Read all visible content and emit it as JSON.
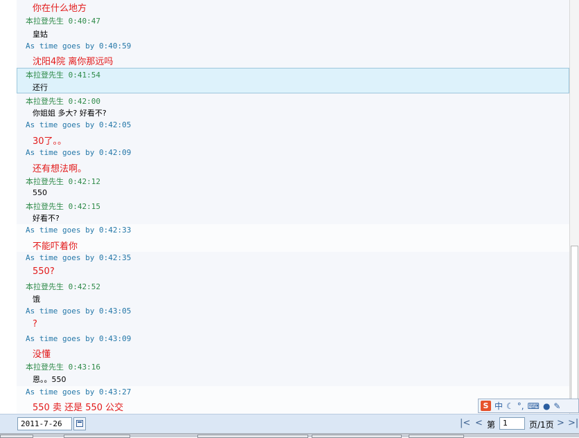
{
  "chat": {
    "messages": [
      {
        "meta": "",
        "text": "你在什么地方",
        "kind": "other"
      },
      {
        "meta": "本拉登先生 0:40:47",
        "text": "皇姑",
        "kind": "self"
      },
      {
        "meta": "As time goes by 0:40:59",
        "text": "沈阳4院 离你那远吗",
        "kind": "other"
      },
      {
        "meta": "本拉登先生 0:41:54",
        "text": "还行",
        "kind": "self"
      },
      {
        "meta": "本拉登先生 0:42:00",
        "text": "你姐姐 多大? 好看不?",
        "kind": "self"
      },
      {
        "meta": "As time goes by 0:42:05",
        "text": "30了。。",
        "kind": "other"
      },
      {
        "meta": "As time goes by 0:42:09",
        "text": "还有想法啊。",
        "kind": "other"
      },
      {
        "meta": "本拉登先生 0:42:12",
        "text": "550",
        "kind": "self"
      },
      {
        "meta": "本拉登先生 0:42:15",
        "text": "好看不?",
        "kind": "self"
      },
      {
        "meta": "As time goes by 0:42:33",
        "text": "不能吓着你",
        "kind": "other"
      },
      {
        "meta": "As time goes by 0:42:35",
        "text": "550?",
        "kind": "other"
      },
      {
        "meta": "本拉登先生 0:42:52",
        "text": "饿",
        "kind": "self"
      },
      {
        "meta": "As time goes by 0:43:05",
        "text": "?",
        "kind": "other"
      },
      {
        "meta": "As time goes by 0:43:09",
        "text": "没懂",
        "kind": "other"
      },
      {
        "meta": "本拉登先生 0:43:16",
        "text": "恩。。550",
        "kind": "self"
      },
      {
        "meta": "As time goes by 0:43:27",
        "text": "550 卖 还是 550 公交",
        "kind": "other"
      }
    ]
  },
  "ime": {
    "logo": "S",
    "mode": "中",
    "moon": "☾",
    "punct": "°,"
  },
  "bottom": {
    "date": "2011-7-26",
    "page_prefix": "第",
    "page_value": "1",
    "page_suffix": "页/1页",
    "first": "|<",
    "prev": "<",
    "next": ">",
    "last": ">|"
  },
  "colors": {
    "self_name": "#2f8b49",
    "other_name": "#2477a8",
    "other_text": "#e21a1a"
  }
}
